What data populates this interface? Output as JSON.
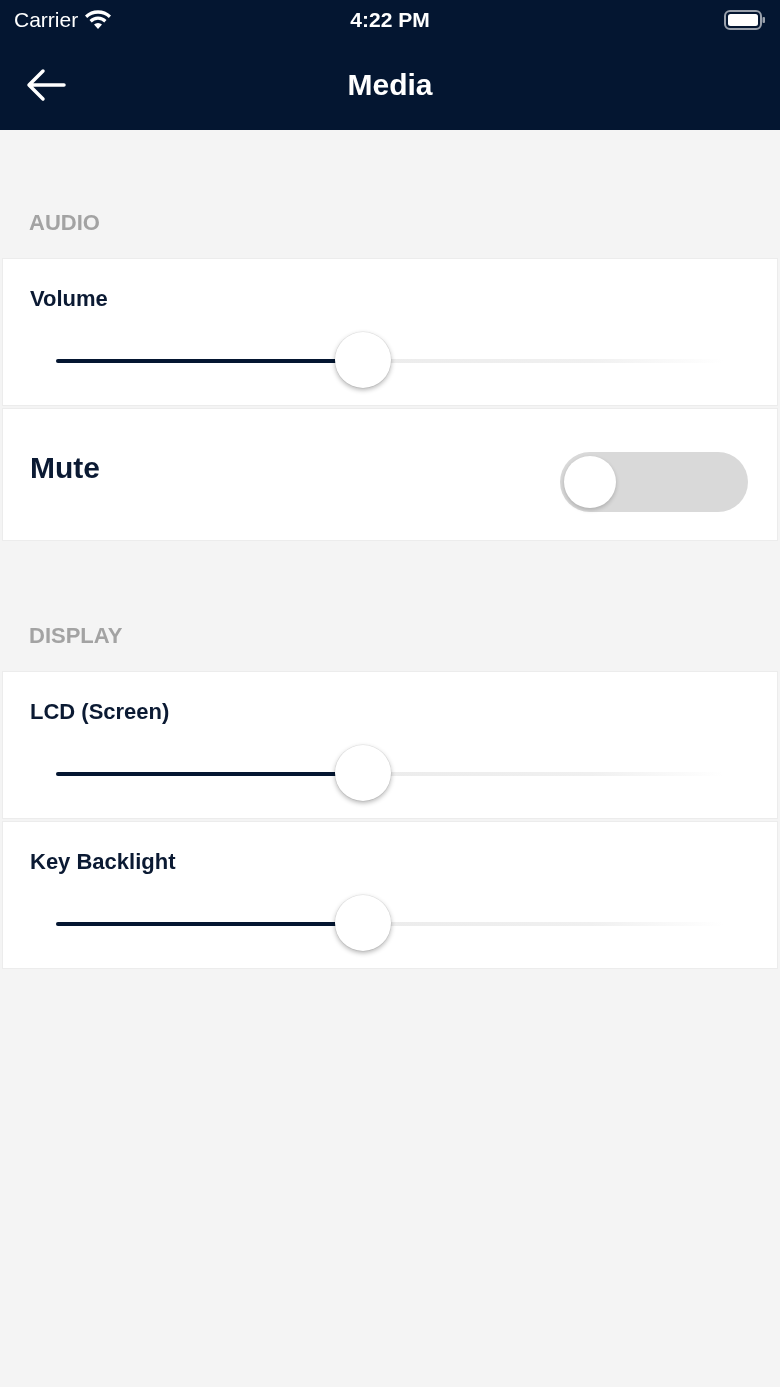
{
  "status_bar": {
    "carrier": "Carrier",
    "time": "4:22 PM"
  },
  "header": {
    "title": "Media"
  },
  "sections": [
    {
      "title": "AUDIO",
      "rows": [
        {
          "kind": "slider",
          "label": "Volume",
          "level": 0.46
        },
        {
          "kind": "toggle",
          "label": "Mute",
          "on": false
        }
      ]
    },
    {
      "title": "DISPLAY",
      "rows": [
        {
          "kind": "slider",
          "label": "LCD (Screen)",
          "level": 0.46
        },
        {
          "kind": "slider",
          "label": "Key Backlight",
          "level": 0.46
        }
      ]
    }
  ]
}
